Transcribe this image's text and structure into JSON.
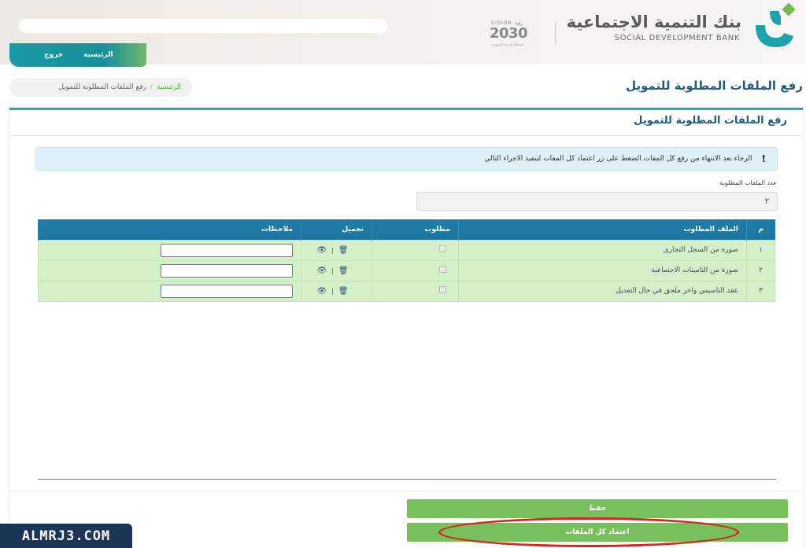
{
  "header": {
    "bank_name_ar": "بنك التنمية الاجتماعية",
    "bank_name_en": "SOCIAL DEVELOPMENT BANK",
    "vision_label": "VISION رؤية",
    "vision_year": "2030",
    "vision_sub": "المملكة العربية السعودية",
    "nav": {
      "home": "الرئيسية",
      "logout": "خروج"
    },
    "search_placeholder": ""
  },
  "breadcrumb": {
    "home": "الرئيسية",
    "separator": "/",
    "current": "رفع الملفات المطلوبة للتمويل"
  },
  "page_title": "رفع الملفات المطلوبة للتمويل",
  "card": {
    "title": "رفع الملفات المطلوبة للتمويل",
    "alert_icon": "!",
    "alert_text": "الرجاء بعد الانتهاء من رفع كل المفات الضغط على زر اعتماد كل المفات لتنفيذ الاجراء التالي",
    "required_count_label": "عدد الملفات المطلوبة",
    "required_count_value": "٣"
  },
  "table": {
    "headers": {
      "num": "م",
      "file": "الملف المطلوب",
      "required": "مطلوب",
      "upload": "تحميل",
      "notes": "ملاحظات"
    },
    "rows": [
      {
        "num": "١",
        "file": "صورة من السجل التجاري",
        "required": true,
        "note": ""
      },
      {
        "num": "٢",
        "file": "صورة من التامينات الاجتماعية",
        "required": true,
        "note": ""
      },
      {
        "num": "٣",
        "file": "عقد التاسيس واخر ملحق في حال التعديل",
        "required": true,
        "note": ""
      }
    ],
    "upload_separator": "|"
  },
  "buttons": {
    "save": "حفظ",
    "approve_all": "اعتماد كل الملفات"
  },
  "watermark": "ALMRJ3.COM",
  "colors": {
    "teal": "#2aa9b1",
    "table_header": "#1e7fa8",
    "row_green": "#d4f0c8",
    "button_green": "#78c05c",
    "highlight_red": "#d6241f"
  },
  "icons": {
    "view": "eye-icon",
    "delete": "trash-icon"
  }
}
